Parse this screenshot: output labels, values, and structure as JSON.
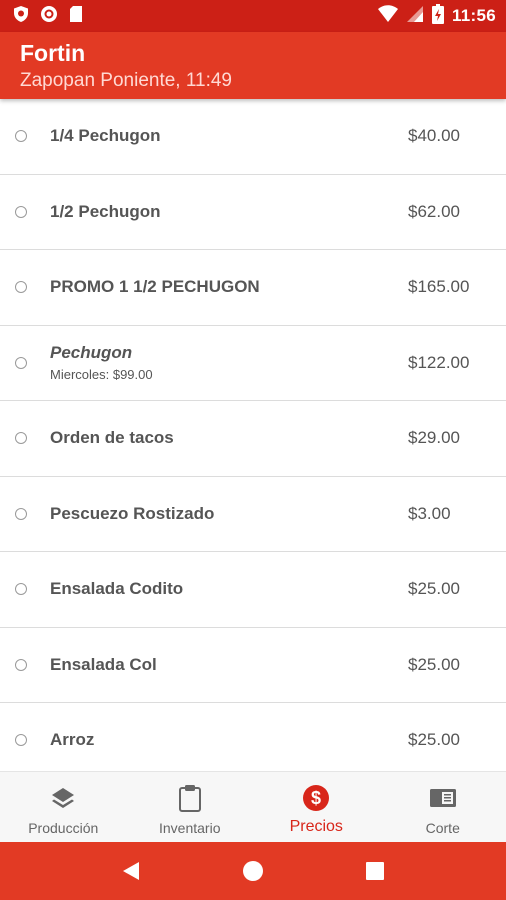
{
  "status_bar": {
    "time": "11:56",
    "icons": [
      "shield-icon",
      "record-icon",
      "sd-card-icon",
      "wifi-icon",
      "signal-icon",
      "battery-charging-icon"
    ]
  },
  "header": {
    "title": "Fortin",
    "subtitle": "Zapopan Poniente, 11:49"
  },
  "items": [
    {
      "name": "1/4 Pechugon",
      "price": "$40.00"
    },
    {
      "name": "1/2 Pechugon",
      "price": "$62.00"
    },
    {
      "name": "PROMO 1 1/2 PECHUGON",
      "price": "$165.00"
    },
    {
      "name": "Pechugon",
      "note": "Miercoles: $99.00",
      "price": "$122.00"
    },
    {
      "name": "Orden de tacos",
      "price": "$29.00"
    },
    {
      "name": "Pescuezo Rostizado",
      "price": "$3.00"
    },
    {
      "name": "Ensalada Codito",
      "price": "$25.00"
    },
    {
      "name": "Ensalada Col",
      "price": "$25.00"
    },
    {
      "name": "Arroz",
      "price": "$25.00"
    }
  ],
  "bottom_nav": {
    "tabs": [
      {
        "label": "Producción",
        "icon": "layers-icon"
      },
      {
        "label": "Inventario",
        "icon": "clipboard-icon"
      },
      {
        "label": "Precios",
        "icon": "dollar-circle-icon",
        "active": true
      },
      {
        "label": "Corte",
        "icon": "receipt-icon"
      }
    ]
  },
  "colors": {
    "status_bar": "#cc2016",
    "app_bar": "#e23a24",
    "accent": "#d8261a",
    "text": "#555555"
  }
}
